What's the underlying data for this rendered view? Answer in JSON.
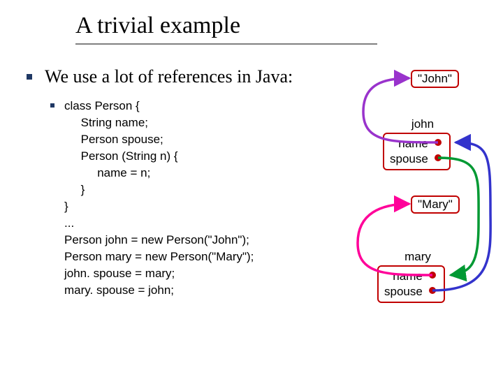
{
  "title": "A trivial example",
  "bullet_text": "We use a lot of references in Java:",
  "code_lines": [
    "class Person {",
    "     String name;",
    "     Person spouse;",
    "     Person (String n) {",
    "          name = n;",
    "     }",
    "}",
    "...",
    "Person john = new Person(\"John\");",
    "Person mary = new Person(\"Mary\");",
    "john. spouse = mary;",
    "mary. spouse = john;"
  ],
  "diagram": {
    "john_string": "\"John\"",
    "mary_string": "\"Mary\"",
    "john_label": "john",
    "mary_label": "mary",
    "field_name": "name",
    "field_spouse": "spouse"
  }
}
